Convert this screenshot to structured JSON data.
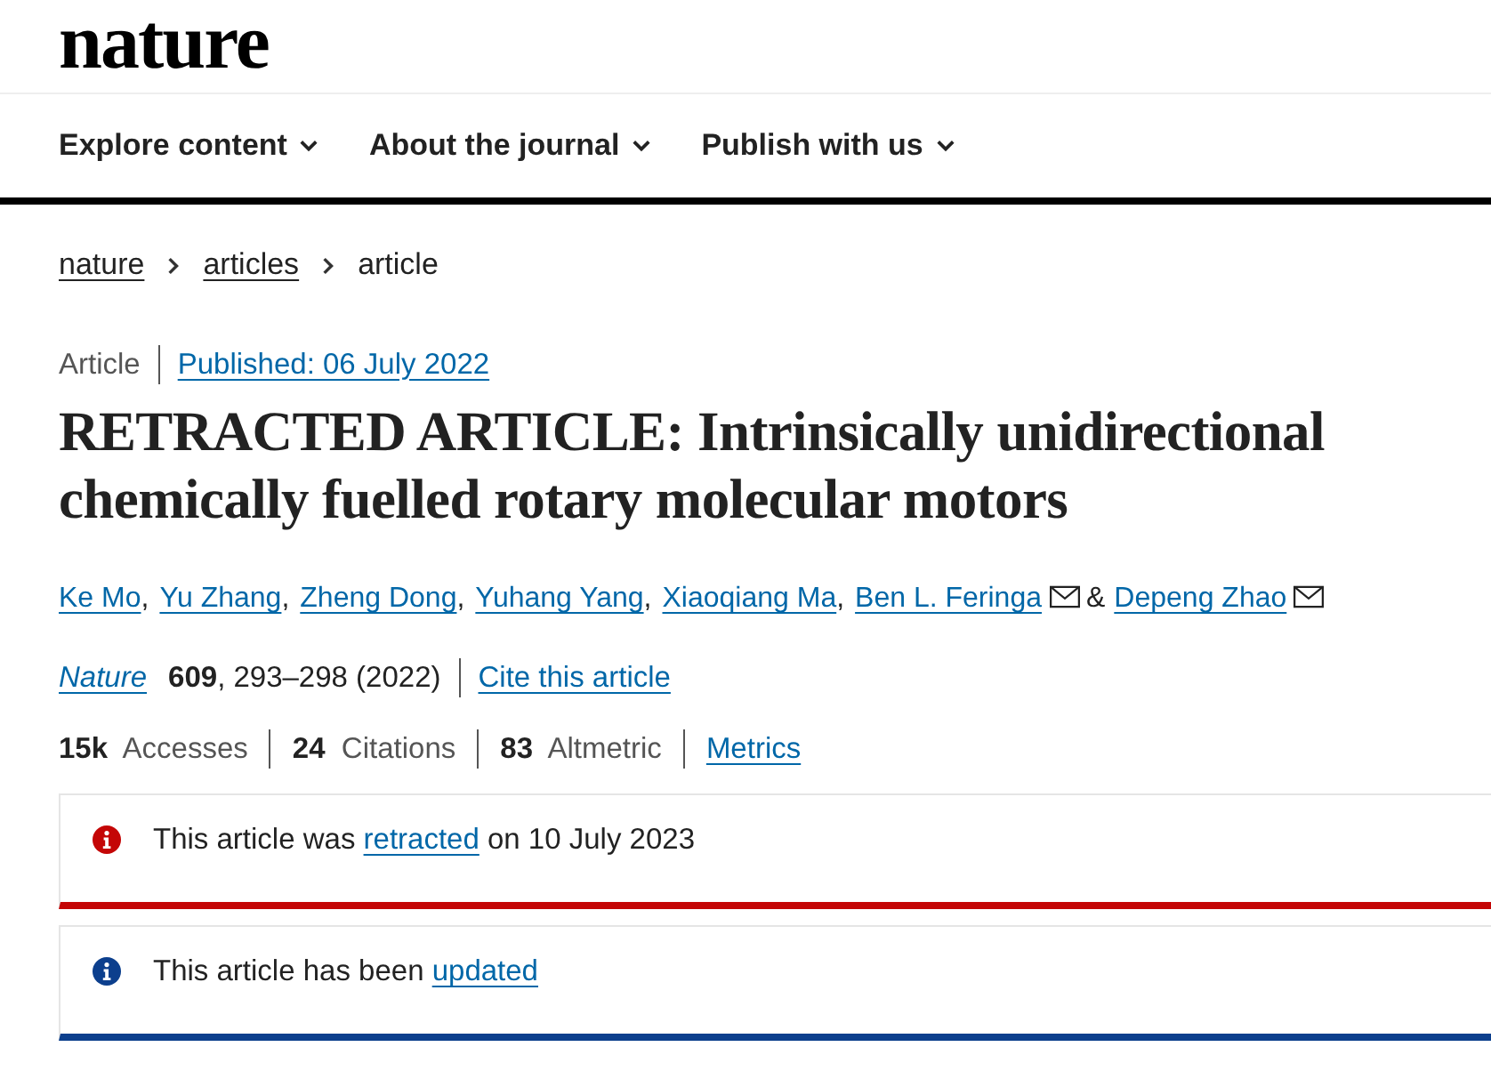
{
  "logo": "nature",
  "nav": [
    {
      "label": "Explore content"
    },
    {
      "label": "About the journal"
    },
    {
      "label": "Publish with us"
    }
  ],
  "breadcrumb": [
    "nature",
    "articles",
    "article"
  ],
  "article_type": "Article",
  "published": "Published: 06 July 2022",
  "title": "RETRACTED ARTICLE: Intrinsically unidirectional chemically fuelled rotary molecular motors",
  "authors": [
    {
      "name": "Ke Mo",
      "suffix": ",",
      "email": false
    },
    {
      "name": "Yu Zhang",
      "suffix": ",",
      "email": false
    },
    {
      "name": "Zheng Dong",
      "suffix": ",",
      "email": false
    },
    {
      "name": "Yuhang Yang",
      "suffix": ",",
      "email": false
    },
    {
      "name": "Xiaoqiang Ma",
      "suffix": ",",
      "email": false
    },
    {
      "name": "Ben L. Feringa",
      "suffix": "&",
      "email": true
    },
    {
      "name": "Depeng Zhao",
      "email": true
    }
  ],
  "citation": {
    "journal": "Nature",
    "volume": "609",
    "pages": ", 293–298 (2022)",
    "cite_link": "Cite this article"
  },
  "metrics": [
    "**15k**  Accesses",
    "**24**  Citations",
    "**83**  Altmetric"
  ],
  "metrics_link": "Metrics",
  "notices": [
    {
      "before": "This article was ",
      "link": "retracted",
      "after": " on 10 July 2023",
      "color": "#c40606"
    },
    {
      "before": "This article has been ",
      "link": "updated",
      "color": "#0c3f8d"
    }
  ]
}
